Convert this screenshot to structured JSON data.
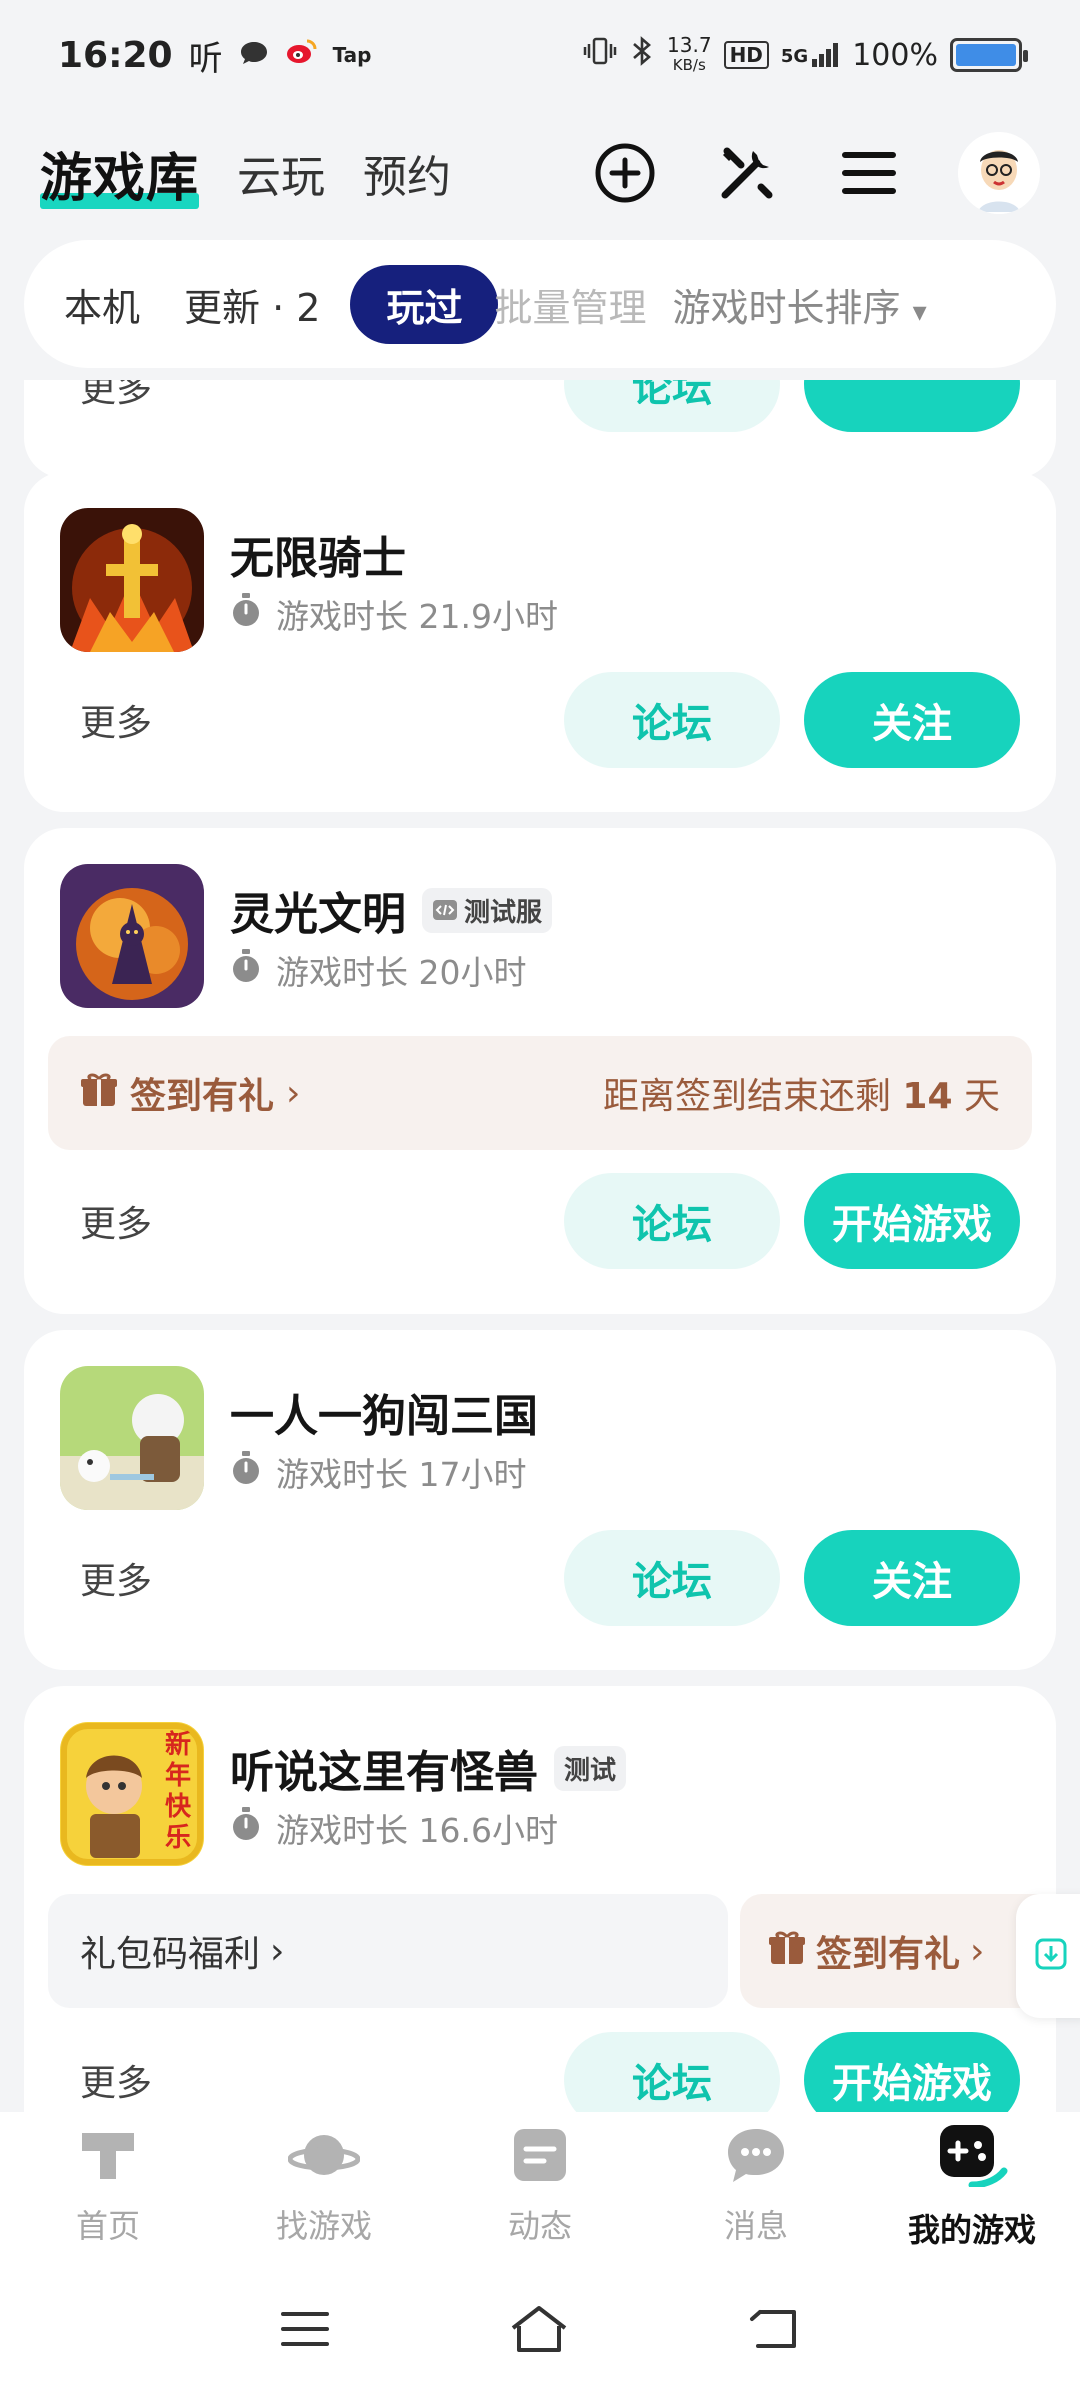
{
  "status": {
    "time": "16:20",
    "speed_value": "13.7",
    "speed_unit": "KB/s",
    "network": "5G",
    "battery_text": "100%",
    "tap_label": "Tap",
    "listen_label": "听"
  },
  "header": {
    "brand": "游戏库",
    "tabs": [
      "云玩",
      "预约"
    ]
  },
  "filters": {
    "chips": [
      "本机",
      "更新 · 2",
      "玩过"
    ],
    "active": "玩过",
    "batch_manage": "批量管理",
    "sort": "游戏时长排序",
    "sort_arrow": "▾"
  },
  "cards": [
    {
      "title": "无限骑士",
      "playtime": "游戏时长 21.9小时",
      "more": "更多",
      "forum": "论坛",
      "action": "关注"
    },
    {
      "title": "灵光文明",
      "tag": "测试服",
      "playtime": "游戏时长 20小时",
      "signin": "签到有礼",
      "signin_arrow": "›",
      "signin_remaining_prefix": "距离签到结束还剩",
      "signin_remaining_days": "14",
      "signin_remaining_suffix": "天",
      "more": "更多",
      "forum": "论坛",
      "action": "开始游戏"
    },
    {
      "title": "一人一狗闯三国",
      "playtime": "游戏时长 17小时",
      "more": "更多",
      "forum": "论坛",
      "action": "关注"
    },
    {
      "title": "听说这里有怪兽",
      "tag": "测试",
      "playtime": "游戏时长 16.6小时",
      "gift_code": "礼包码福利",
      "signin": "签到有礼",
      "arrow": "›",
      "icon_text": "新年快乐",
      "more": "更多",
      "forum": "论坛",
      "action": "开始游戏"
    }
  ],
  "partial_card": {
    "forum": "论坛",
    "more": "更多"
  },
  "bottom_nav": [
    {
      "label": "首页",
      "icon": "home-icon"
    },
    {
      "label": "找游戏",
      "icon": "planet-icon"
    },
    {
      "label": "动态",
      "icon": "feed-icon"
    },
    {
      "label": "消息",
      "icon": "message-icon"
    },
    {
      "label": "我的游戏",
      "icon": "gamepad-icon",
      "active": true
    }
  ],
  "colors": {
    "accent": "#17d3bd",
    "accent_light": "#e7f8f6",
    "active_chip": "#16207d",
    "signin_text": "#9a5b3c"
  }
}
